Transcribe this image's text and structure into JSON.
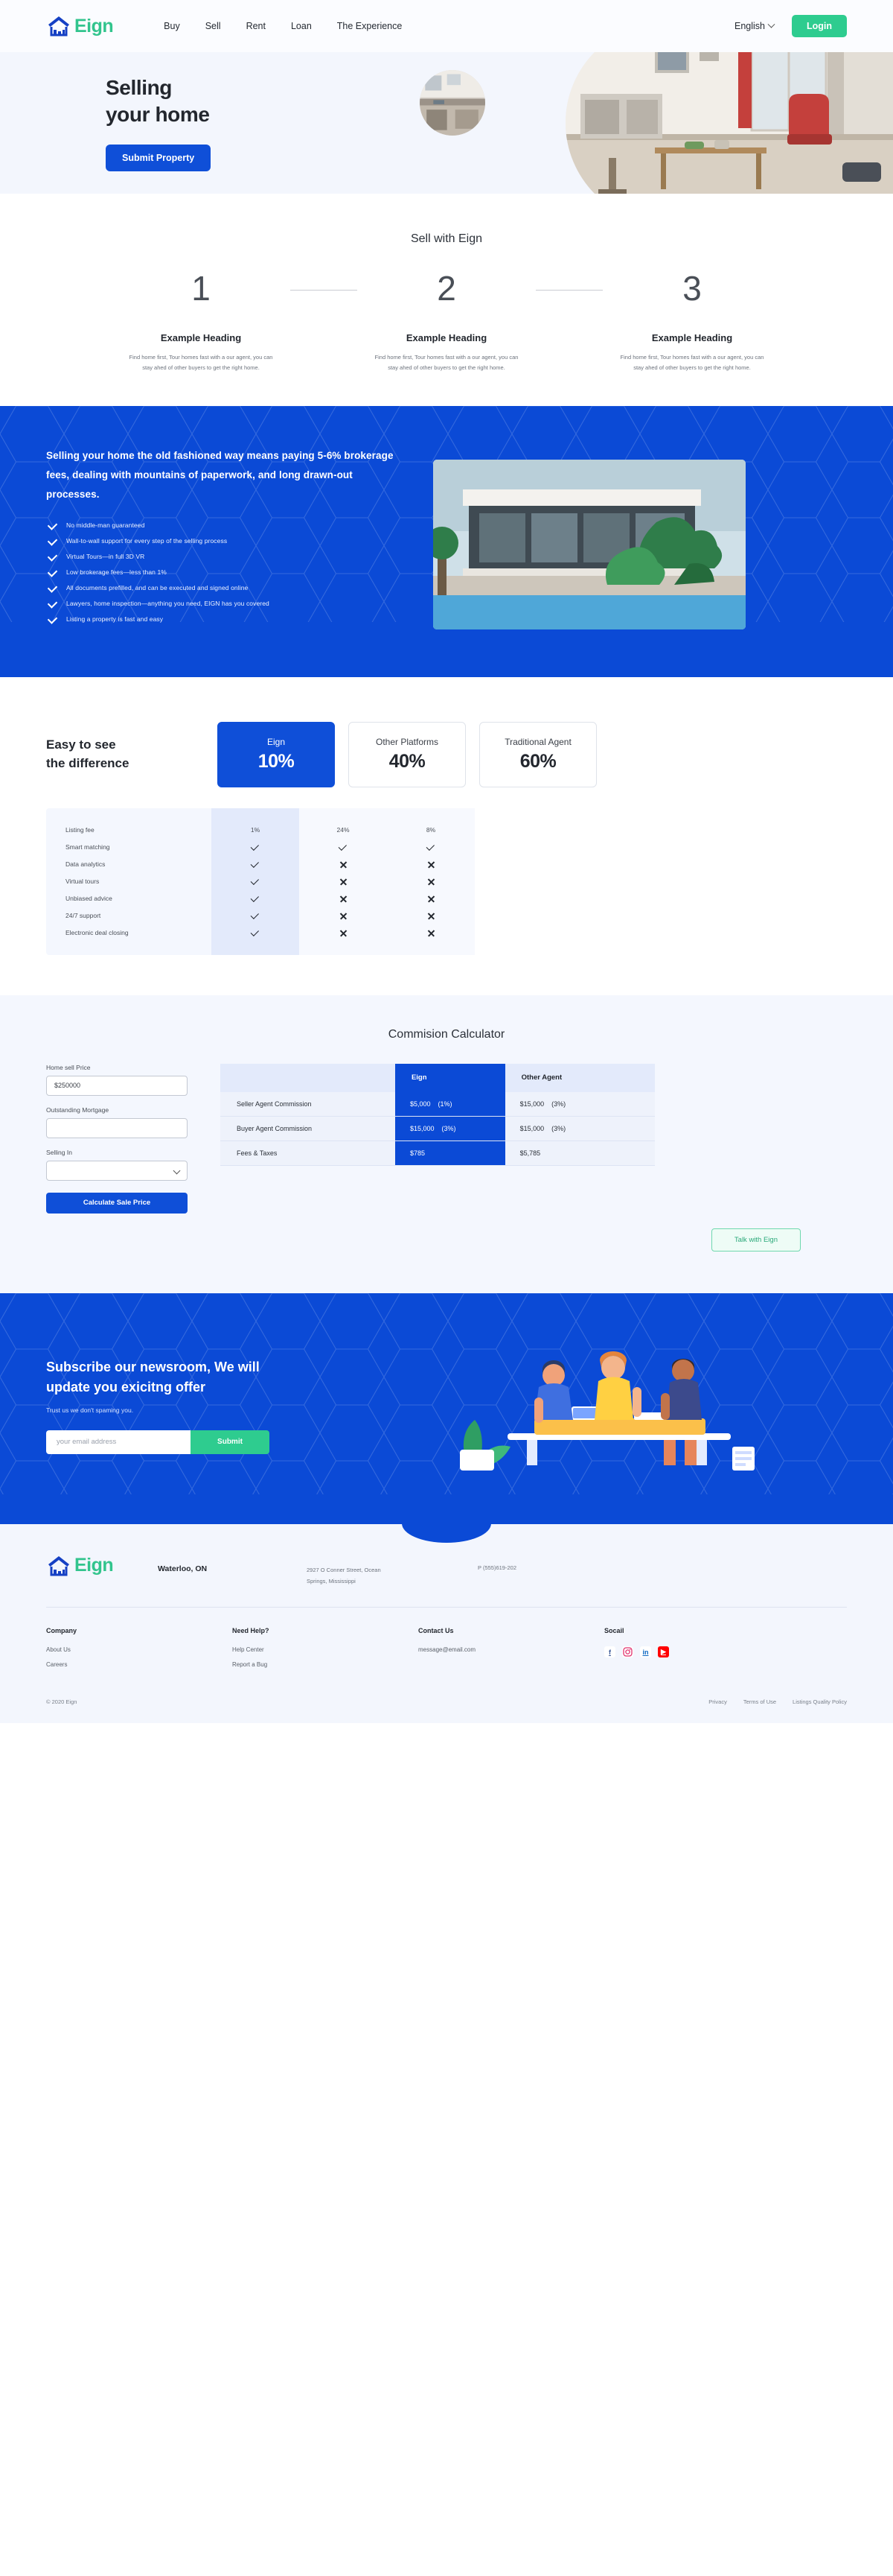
{
  "brand": {
    "name": "Eign",
    "accent_green": "#2ecc8f",
    "accent_blue": "#0f4fd8",
    "deep_blue": "#0b4ad6"
  },
  "header": {
    "nav": [
      {
        "label": "Buy"
      },
      {
        "label": "Sell"
      },
      {
        "label": "Rent"
      },
      {
        "label": "Loan"
      },
      {
        "label": "The Experience"
      }
    ],
    "language": "English",
    "login_label": "Login"
  },
  "hero": {
    "title_line1": "Selling",
    "title_line2": "your home",
    "cta_label": "Submit Property"
  },
  "steps_section": {
    "title": "Sell with Eign",
    "steps": [
      {
        "number": "1",
        "heading": "Example Heading",
        "text": "Find home first, Tour homes fast with a our agent, you can stay ahed of other buyers to get the right home."
      },
      {
        "number": "2",
        "heading": "Example Heading",
        "text": "Find home first, Tour homes fast with a our agent, you can stay ahed of other buyers to get the right home."
      },
      {
        "number": "3",
        "heading": "Example Heading",
        "text": "Find home first, Tour homes fast with a our agent, you can stay ahed of other buyers to get the right home."
      }
    ]
  },
  "blue_band": {
    "lead": "Selling your home the old fashioned way means paying 5-6% brokerage fees, dealing with mountains of paperwork, and long drawn-out processes.",
    "features": [
      "No middle-man guaranteed",
      "Wall-to-wall support for every step of the selling process",
      "Virtual Tours—in full 3D VR",
      "Low brokerage fees—less than 1%",
      "All documents prefilled, and can be executed and signed online",
      "Lawyers, home inspection—anything you need, EIGN has you covered",
      "Listing a property is fast and easy"
    ]
  },
  "comparison": {
    "title_line1": "Easy to see",
    "title_line2": "the difference",
    "cards": [
      {
        "label": "Eign",
        "value": "10%",
        "primary": true
      },
      {
        "label": "Other Platforms",
        "value": "40%",
        "primary": false
      },
      {
        "label": "Traditional Agent",
        "value": "60%",
        "primary": false
      }
    ],
    "rows": [
      {
        "feature": "Listing fee",
        "eign": "1%",
        "other_platforms": "24%",
        "traditional": "8%",
        "type": "text"
      },
      {
        "feature": "Smart matching",
        "eign": "check",
        "other_platforms": "check",
        "traditional": "check",
        "type": "icon"
      },
      {
        "feature": "Data analytics",
        "eign": "check",
        "other_platforms": "cross",
        "traditional": "cross",
        "type": "icon"
      },
      {
        "feature": "Virtual tours",
        "eign": "check",
        "other_platforms": "cross",
        "traditional": "cross",
        "type": "icon"
      },
      {
        "feature": "Unbiased advice",
        "eign": "check",
        "other_platforms": "cross",
        "traditional": "cross",
        "type": "icon"
      },
      {
        "feature": "24/7 support",
        "eign": "check",
        "other_platforms": "cross",
        "traditional": "cross",
        "type": "icon"
      },
      {
        "feature": "Electronic deal closing",
        "eign": "check",
        "other_platforms": "cross",
        "traditional": "cross",
        "type": "icon"
      }
    ]
  },
  "calculator": {
    "title": "Commision Calculator",
    "fields": {
      "home_price_label": "Home sell Price",
      "home_price_value": "$250000",
      "mortgage_label": "Outstanding Mortgage",
      "mortgage_value": "",
      "selling_in_label": "Selling In",
      "selling_in_value": ""
    },
    "button_label": "Calculate Sale Price",
    "table": {
      "columns": [
        "",
        "Eign",
        "Other Agent"
      ],
      "rows": [
        {
          "label": "Seller Agent Commission",
          "eign_amount": "$5,000",
          "eign_pct": "(1%)",
          "other_amount": "$15,000",
          "other_pct": "(3%)"
        },
        {
          "label": "Buyer Agent Commission",
          "eign_amount": "$15,000",
          "eign_pct": "(3%)",
          "other_amount": "$15,000",
          "other_pct": "(3%)"
        },
        {
          "label": "Fees & Taxes",
          "eign_amount": "$785",
          "eign_pct": "",
          "other_amount": "$5,785",
          "other_pct": ""
        }
      ]
    },
    "talk_button_label": "Talk with Eign"
  },
  "newsletter": {
    "heading_line1": "Subscribe our newsroom, We will",
    "heading_line2": "update you exicitng offer",
    "subtext": "Trust us we don't spaming you.",
    "email_placeholder": "your email address",
    "submit_label": "Submit"
  },
  "footer": {
    "brand": "Eign",
    "city": "Waterloo, ON",
    "address_line1": "2927  O Conner Street, Ocean",
    "address_line2": "Springs, Mississippi",
    "phone": "P (555)619-202",
    "columns": [
      {
        "heading": "Company",
        "items": [
          "About Us",
          "Careers"
        ]
      },
      {
        "heading": "Need Help?",
        "items": [
          "Help Center",
          "Report a Bug"
        ]
      },
      {
        "heading": "Contact Us",
        "items": [
          "message@email.com"
        ]
      }
    ],
    "social_heading": "Socail",
    "socials": [
      "facebook-icon",
      "instagram-icon",
      "linkedin-icon",
      "youtube-icon"
    ],
    "copyright": "© 2020 Eign",
    "legal": [
      "Privacy",
      "Terms of Use",
      "Listings Quality Policy"
    ]
  }
}
